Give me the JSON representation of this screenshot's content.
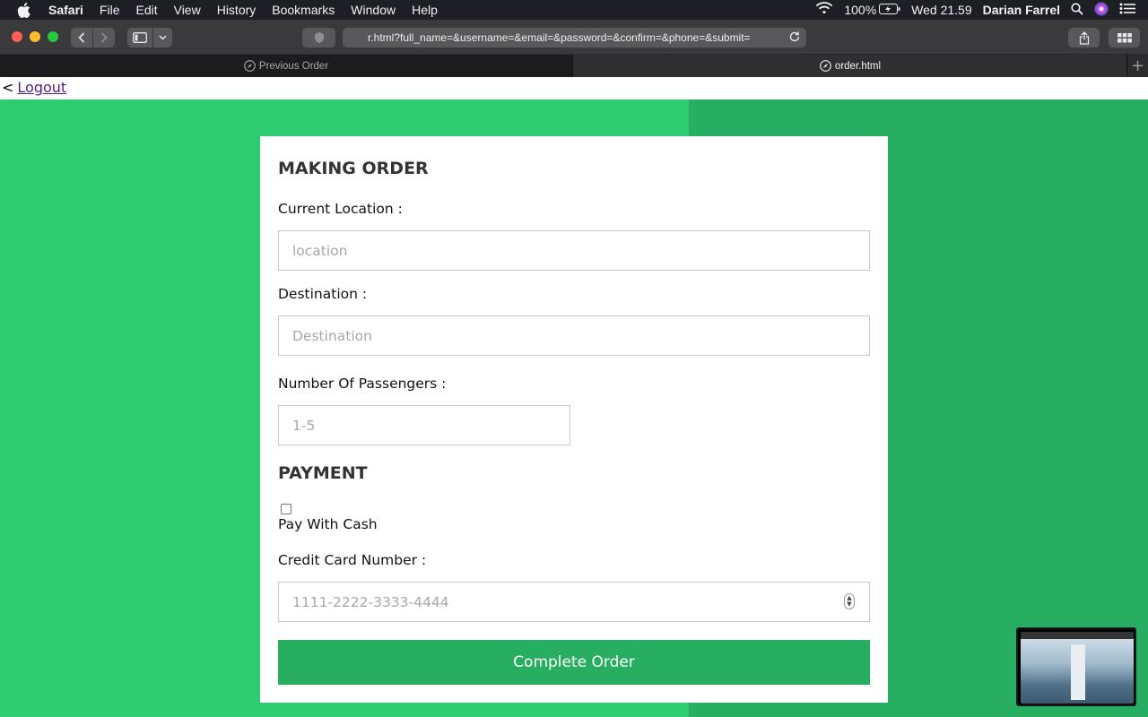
{
  "menubar": {
    "app_name": "Safari",
    "menus": [
      "File",
      "Edit",
      "View",
      "History",
      "Bookmarks",
      "Window",
      "Help"
    ],
    "battery": "100%",
    "clock": "Wed 21.59",
    "user": "Darian Farrel"
  },
  "browser": {
    "url": "r.html?full_name=&username=&email=&password=&confirm=&phone=&submit=",
    "tabs": [
      {
        "label": "Previous Order",
        "active": false
      },
      {
        "label": "order.html",
        "active": true
      }
    ]
  },
  "page": {
    "back_arrow": "<",
    "logout_label": "Logout",
    "form": {
      "title": "MAKING ORDER",
      "location_label": "Current Location :",
      "location_placeholder": "location",
      "destination_label": "Destination :",
      "destination_placeholder": "Destination",
      "passengers_label": "Number Of Passengers :",
      "passengers_placeholder": "1-5",
      "payment_title": "PAYMENT",
      "cash_checked": false,
      "cash_label": "Pay With Cash",
      "card_label": "Credit Card Number :",
      "card_placeholder": "1111-2222-3333-4444",
      "submit_label": "Complete Order"
    }
  },
  "colors": {
    "accent_left": "#2ecc71",
    "accent_right": "#27ae60",
    "button": "#27ae60"
  }
}
